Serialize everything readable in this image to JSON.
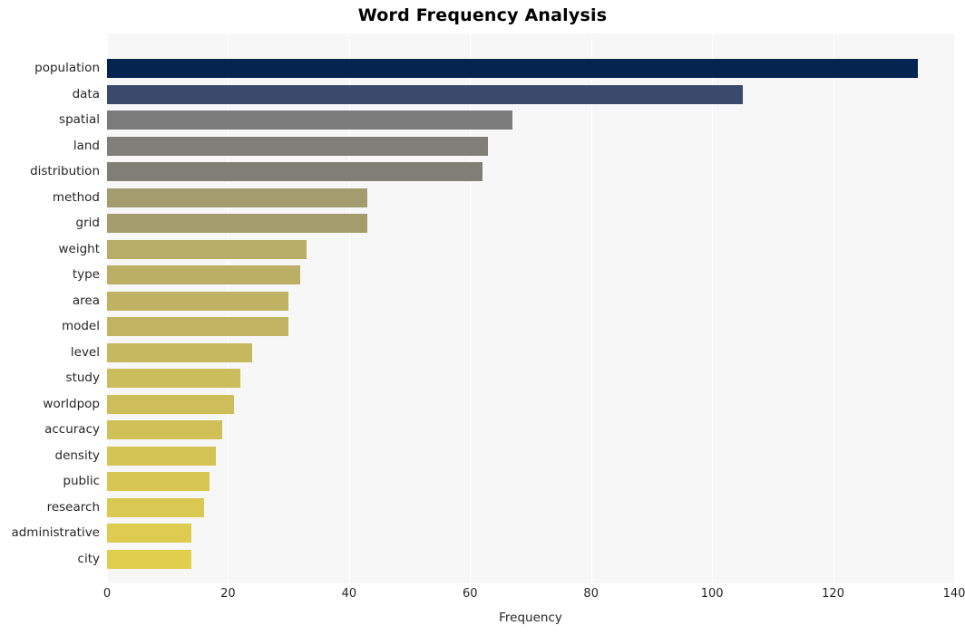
{
  "chart_data": {
    "type": "bar",
    "orientation": "horizontal",
    "title": "Word Frequency Analysis",
    "xlabel": "Frequency",
    "ylabel": "",
    "xlim": [
      0,
      140
    ],
    "ylim": null,
    "grid": true,
    "legend": null,
    "xticks": [
      0,
      20,
      40,
      60,
      80,
      100,
      120,
      140
    ],
    "xtick_labels": [
      "0",
      "20",
      "40",
      "60",
      "80",
      "100",
      "120",
      "140"
    ],
    "categories": [
      "population",
      "data",
      "spatial",
      "land",
      "distribution",
      "method",
      "grid",
      "weight",
      "type",
      "area",
      "model",
      "level",
      "study",
      "worldpop",
      "accuracy",
      "density",
      "public",
      "research",
      "administrative",
      "city"
    ],
    "values": [
      134,
      105,
      67,
      63,
      62,
      43,
      43,
      33,
      32,
      30,
      30,
      24,
      22,
      21,
      19,
      18,
      17,
      16,
      14,
      14
    ],
    "bar_colors": [
      "#052450",
      "#3a4a6d",
      "#7b7b7b",
      "#7f7e78",
      "#807f76",
      "#a39c6f",
      "#a39c6d",
      "#b8ad68",
      "#bbaf66",
      "#bfb263",
      "#c0b362",
      "#c6b85f",
      "#cbbc5c",
      "#cdbe5b",
      "#d0c058",
      "#d4c456",
      "#d7c653",
      "#d9c852",
      "#ddcc4f",
      "#e0ce4d"
    ],
    "plot_background": "#f7f7f7",
    "grid_color": "#ffffff",
    "figure_background": "#ffffff"
  }
}
